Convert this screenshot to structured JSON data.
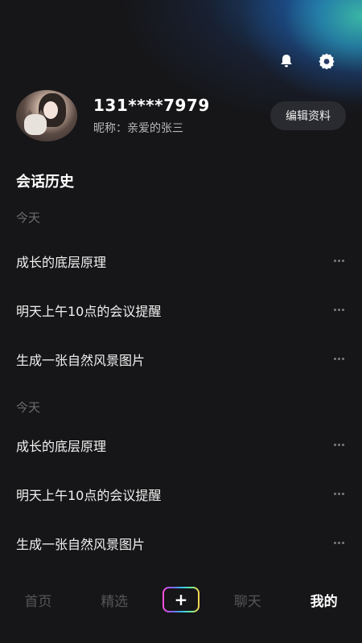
{
  "header": {
    "icons": [
      "bell-icon",
      "gear-icon"
    ]
  },
  "profile": {
    "phone": "131****7979",
    "nickname_label": "昵称：",
    "nickname": "亲爱的张三",
    "edit_label": "编辑资料"
  },
  "history": {
    "title": "会话历史",
    "groups": [
      {
        "label": "今天",
        "items": [
          "成长的底层原理",
          "明天上午10点的会议提醒",
          "生成一张自然风景图片"
        ]
      },
      {
        "label": "今天",
        "items": [
          "成长的底层原理",
          "明天上午10点的会议提醒",
          "生成一张自然风景图片"
        ]
      }
    ]
  },
  "tabbar": {
    "tabs": [
      "首页",
      "精选",
      "+",
      "聊天",
      "我的"
    ],
    "active": "我的"
  },
  "colors": {
    "background": "#161618",
    "accent_glow": "#3cbeaa"
  }
}
